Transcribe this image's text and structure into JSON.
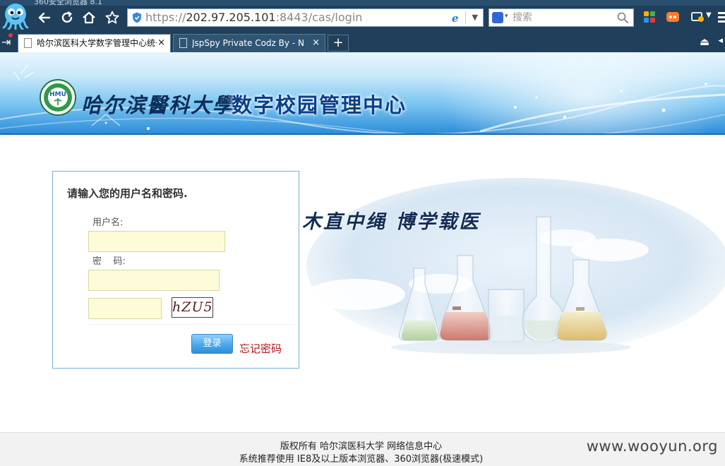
{
  "browser": {
    "title": "360安全浏览器 8.1",
    "address": {
      "protocol": "https://",
      "host": "202.97.205.101",
      "path": ":8443/cas/login"
    },
    "search": {
      "placeholder": "搜索"
    },
    "tabs": [
      {
        "label": "哈尔滨医科大学数字管理中心统一身份认证",
        "close": "×",
        "active": true
      },
      {
        "label": "JspSpy Private Codz By - Ninty",
        "close": "×",
        "active": false
      }
    ],
    "new_tab": "+",
    "icons": {
      "back": "back-arrow-icon",
      "forward": "reload-icon",
      "home": "home-icon",
      "favorite": "star-icon"
    }
  },
  "header": {
    "university_name": "哈尔滨醫科大學",
    "system_name": "数字校园管理中心",
    "logo_text": "HMU"
  },
  "login": {
    "title": "请输入您的用户名和密码.",
    "username_label": "用户名:",
    "password_label": "密    码:",
    "username_value": "",
    "password_value": "",
    "captcha_value": "",
    "captcha_text": "hZU5",
    "submit_label": "登录",
    "forgot_label": "忘记密码"
  },
  "illustration": {
    "slogan": "木直中绳  博学载医"
  },
  "footer": {
    "line1": "版权所有  哈尔滨医科大学  网络信息中心",
    "line2": "系统推荐使用  IE8及以上版本浏览器、360浏览器(极速模式)"
  },
  "watermark": "www.wooyun.org",
  "colors": {
    "chrome": "#1f3f5a",
    "banner_blue": "#2e8ed9",
    "panel_border": "#7ab0d8",
    "input_bg": "#fefcd8",
    "button_blue": "#4aa9ec",
    "forgot_red": "#b31515"
  }
}
